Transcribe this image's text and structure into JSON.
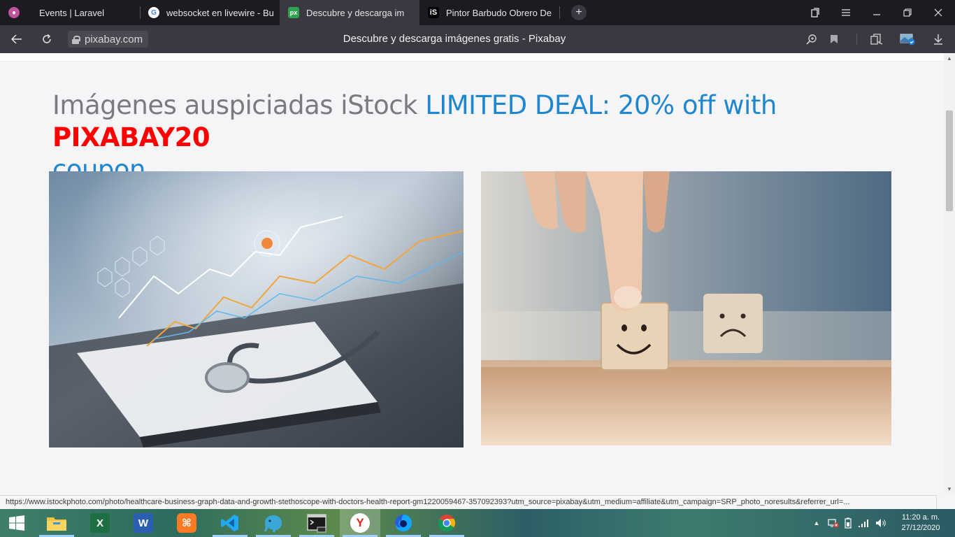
{
  "browser": {
    "tabs": [
      {
        "title": "Events | Laravel",
        "icon": "laravel-events-icon",
        "active": false
      },
      {
        "title": "websocket en livewire - Bu",
        "icon": "google-icon",
        "active": false
      },
      {
        "title": "Descubre y descarga im",
        "icon": "pixabay-icon",
        "active": true
      },
      {
        "title": "Pintor Barbudo Obrero De",
        "icon": "istock-icon",
        "active": false
      }
    ],
    "new_tab_label": "+",
    "url": "pixabay.com",
    "page_title": "Descubre y descarga imágenes gratis - Pixabay"
  },
  "page": {
    "heading_gray": "Imágenes auspiciadas iStock ",
    "heading_deal": "LIMITED DEAL: 20% off with ",
    "heading_code": "PIXABAY20",
    "heading_tail": "coupon",
    "images": [
      {
        "name": "healthcare-graph-stethoscope-photo",
        "subject": "Stethoscope on clipboard with growth graph overlay"
      },
      {
        "name": "happy-sad-face-blocks-photo",
        "subject": "Finger on wooden block with smiley face next to sad face block"
      }
    ]
  },
  "status_bar": {
    "url": "https://www.istockphoto.com/photo/healthcare-business-graph-data-and-growth-stethoscope-with-doctors-health-report-gm1220059467-357092393?utm_source=pixabay&utm_medium=affiliate&utm_campaign=SRP_photo_noresults&referrer_url=..."
  },
  "taskbar": {
    "apps": [
      {
        "name": "windows-start",
        "glyph": "⊞"
      },
      {
        "name": "file-explorer",
        "glyph": ""
      },
      {
        "name": "excel",
        "glyph": "X"
      },
      {
        "name": "word",
        "glyph": "W"
      },
      {
        "name": "xampp",
        "glyph": "⌘"
      },
      {
        "name": "vscode",
        "glyph": "❯"
      },
      {
        "name": "tableplus",
        "glyph": ""
      },
      {
        "name": "terminal",
        "glyph": ""
      },
      {
        "name": "yandex-browser",
        "glyph": "Y"
      },
      {
        "name": "firefox",
        "glyph": ""
      },
      {
        "name": "chrome",
        "glyph": ""
      }
    ],
    "clock_time": "11:20 a. m.",
    "clock_date": "27/12/2020"
  },
  "colors": {
    "tab_bg": "#1c1b22",
    "toolbar_bg": "#3a3942",
    "heading_gray": "#7a7a80",
    "deal_blue": "#1f86d0",
    "coupon_red": "#ff0000"
  }
}
